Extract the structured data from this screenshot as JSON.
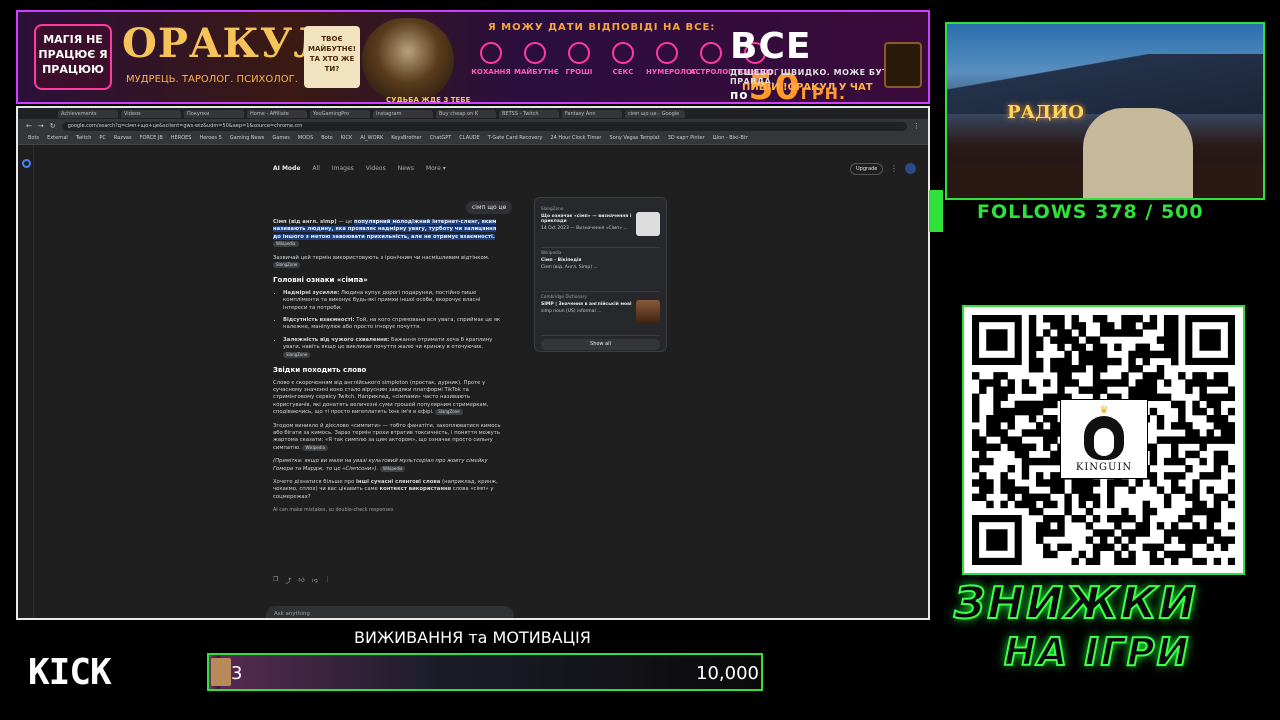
{
  "banner": {
    "magic_text": "МАГІЯ НЕ ПРАЦЮЄ Я ПРАЦЮЮ",
    "brand": "ОРАКУЛ",
    "tagline": "МУДРЕЦЬ. ТАРОЛОГ. ПСИХОЛОГ.",
    "future_card": "ТВОЄ МАЙБУТНЄ! ТА ХТО ЖЕ ТИ?",
    "wizard_caption": "СУДЬБА ЖДЕ З ТЕБЕ",
    "answer_header": "Я МОЖУ ДАТИ ВІДПОВІДІ НА ВСЕ:",
    "categories": [
      "КОХАННЯ",
      "МАЙБУТНЄ",
      "ГРОШІ",
      "СЕКС",
      "НУМЕРОЛОГ",
      "АСТРОЛОГ",
      "ПСИХОЛОГ"
    ],
    "price_all": "ВСЕ",
    "price_by": "по",
    "price_value": "50",
    "price_currency": "ГРН.",
    "slogan": "ДЕШЕВО. ШВИДКО. МОЖЕ БУТИ ПРАВДА.",
    "cta": "ПИШИ !ОРАКУЛ У ЧАТ"
  },
  "browser": {
    "tabs": [
      "Achievements",
      "Videos",
      "Покупки",
      "Home - Affiliate",
      "YouGamingPro",
      "Instagram",
      "Buy cheap on K",
      "BETSS - Twitch",
      "Fantasy Ann",
      "сімп що це - Google"
    ],
    "url": "google.com/search?q=сімп+що+це&sclient=gws-wiz&udm=50&aep=1&source=chrome.crn",
    "bookmarks": [
      "Bots",
      "External",
      "Twitch",
      "PC",
      "Razvas",
      "FORCE JB",
      "HEROES",
      "Heroes 5",
      "Gaming News",
      "Games",
      "MODS",
      "Boto",
      "KICK",
      "AI_WORK",
      "KeysBrother",
      "ChatGPT",
      "CLAUDE",
      "T-Gate Card Recovery",
      "24 Hour Clock Timer",
      "Sony Vegas Templat",
      "3D карт Pinter",
      "Шоп - Вікі-Віт"
    ],
    "nav": [
      "AI Mode",
      "All",
      "Images",
      "Videos",
      "News",
      "More ▾"
    ],
    "upgrade": "Upgrade",
    "query": "сімп що це",
    "answer": {
      "intro_a": "Сімп (від англ. simp)",
      "intro_b": " — це ",
      "intro_hl": "популярний молодіжний інтернет-сленг, яким називають людину, яка проявляє надмірну увагу, турботу чи залицяння до іншого з метою завоювати прихильність, але не отримує взаємності.",
      "chip_wiki": "Wikipedia",
      "p2": "Зазвичай цей термін використовують з іронічним чи насмішливим відтінком.",
      "chip_slang": "SlangZone",
      "h_signs": "Головні ознаки «сімпа»",
      "signs": [
        {
          "b": "Надмірні зусилля:",
          "t": " Людина купує дорогі подарунки, постійно пише компліменти та виконує будь-які примхи іншої особи, вкорочує власні інтереси та потреби."
        },
        {
          "b": "Відсутність взаємності:",
          "t": " Той, на кого спрямована вся увага, сприймає це як належне, маніпулює або просто ігнорує почуття."
        },
        {
          "b": "Залежність від чужого схвалення:",
          "t": " Бажання отримати хоча б краплину уваги, навіть якщо це викликає почуття жалю чи кринжу в оточуючих."
        }
      ],
      "h_origin": "Звідки походить слово",
      "p_origin": "Слово є скороченням від англійського simpleton (простак, дурник). Проте у сучасному значенні воно стало вірусним завдяки платформі TikTok та стримінговому сервісу Twitch. Наприклад, «сімпами» часто називають користувачів, які донатять величезні суми грошей популярним стримеркам, сподіваючись, що ті просто вигеплатять їхнє ім'я в ефірі.",
      "p_verb": "Згодом виникло й дієслово «симпити» — тобто фанатіти, захоплюватися кимось або бігати за кимось. Зараз термін трохи втратив токсичність, і поняття можуть жартома сказати: «Я так симплю за цим актором», що означає просто сильну симпатію.",
      "p_note": "(Примітка: якщо ви мали на увазі культовий мультсеріал про жовту сімейку Гомера та Мардж, то це «Сімпсони»).",
      "p_more_a": "Хочете дізнатися більше про ",
      "p_more_b": "інші сучасні сленгові слова",
      "p_more_c": " (наприклад, кринж, чекаємо, сплох) чи вас цікавить саме ",
      "p_more_d": "контекст використання",
      "p_more_e": " слова «сімп» у соцмережах?",
      "disclaimer": "AI can make mistakes, so double-check responses"
    },
    "sources": [
      {
        "site": "SlangZone",
        "title": "Що означає «сімп» — визначення і приклади",
        "desc": "14 Oct 2023 — Визначення «Сімп» ..."
      },
      {
        "site": "Wikipedia",
        "title": "Сімп - Вікіпедія",
        "desc": "Сімп (від. Англ. Simp) ..."
      },
      {
        "site": "Cambridge Dictionary",
        "title": "SIMP | Значення в англійській мові",
        "desc": "simp noun (US) informal ..."
      }
    ],
    "show_all": "Show all",
    "ask_placeholder": "Ask anything"
  },
  "stream": {
    "follows_label": "FOLLOWS",
    "follows_current": "378",
    "follows_goal": "500",
    "webcam_sign": "РАДИО",
    "kinguin_name": "KINGUIN",
    "sale_line1": "ЗНИЖКИ",
    "sale_line2": "НА ІГРИ",
    "platform": "KICK",
    "goal_title": "ВИЖИВАННЯ та МОТИВАЦІЯ",
    "goal_current": "3",
    "goal_target": "10,000"
  },
  "colors": {
    "accent_green": "#2fe23a",
    "banner_pink": "#d43cff"
  }
}
